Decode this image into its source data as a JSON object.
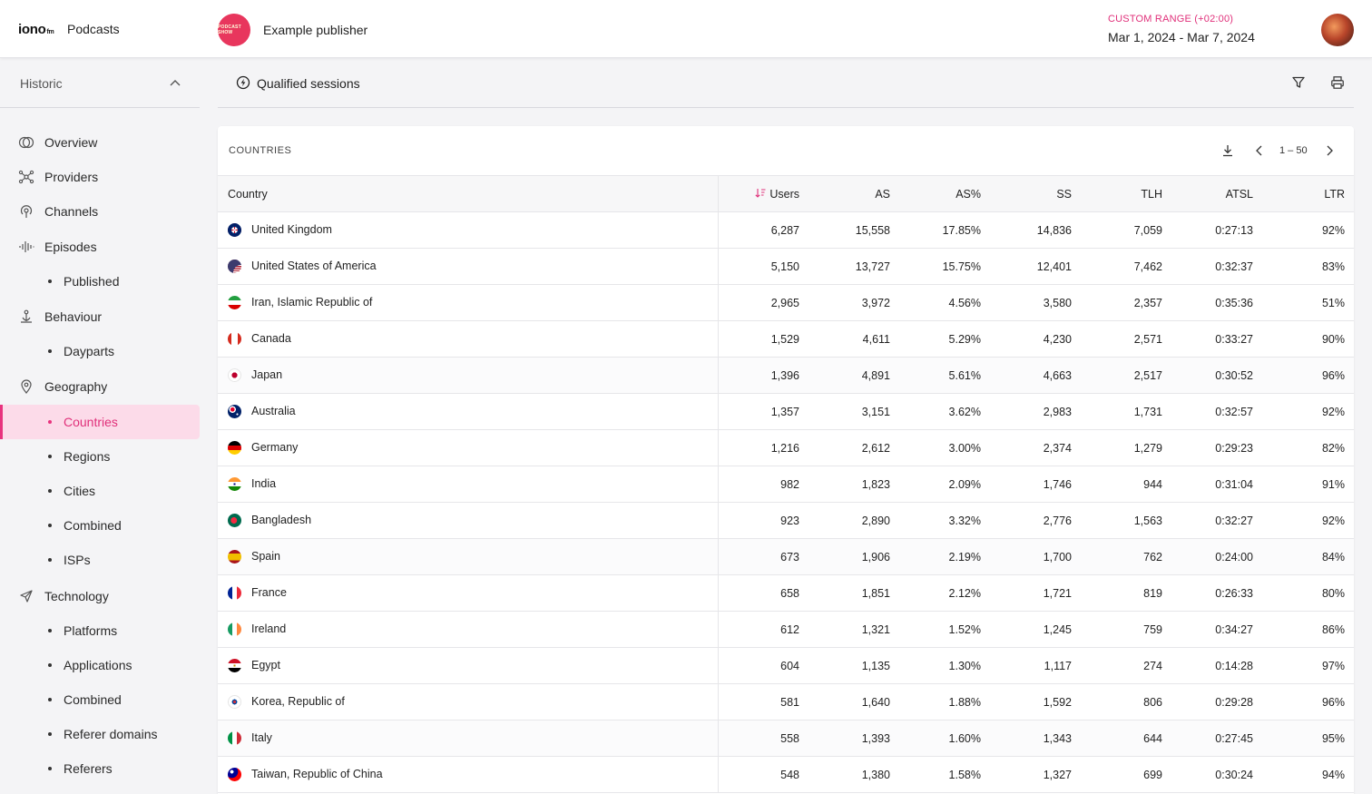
{
  "brand": {
    "logo": "iono",
    "logo_suffix": "fm",
    "app_name": "Podcasts"
  },
  "publisher": {
    "name": "Example publisher",
    "avatar_text": "PODCAST SHOW",
    "avatar_color": "#e8365d"
  },
  "date_range": {
    "label": "CUSTOM RANGE (+02:00)",
    "value": "Mar 1, 2024 - Mar 7, 2024"
  },
  "sidebar": {
    "section": "Historic",
    "items": [
      {
        "label": "Overview",
        "icon": "overview-icon"
      },
      {
        "label": "Providers",
        "icon": "providers-icon"
      },
      {
        "label": "Channels",
        "icon": "channels-icon"
      },
      {
        "label": "Episodes",
        "icon": "episodes-icon"
      },
      {
        "label": "Published",
        "sub": true
      },
      {
        "label": "Behaviour",
        "icon": "behaviour-icon"
      },
      {
        "label": "Dayparts",
        "sub": true
      },
      {
        "label": "Geography",
        "icon": "geography-icon"
      },
      {
        "label": "Countries",
        "sub": true,
        "active": true
      },
      {
        "label": "Regions",
        "sub": true
      },
      {
        "label": "Cities",
        "sub": true
      },
      {
        "label": "Combined",
        "sub": true
      },
      {
        "label": "ISPs",
        "sub": true
      },
      {
        "label": "Technology",
        "icon": "technology-icon"
      },
      {
        "label": "Platforms",
        "sub": true
      },
      {
        "label": "Applications",
        "sub": true
      },
      {
        "label": "Combined",
        "sub": true
      },
      {
        "label": "Referer domains",
        "sub": true
      },
      {
        "label": "Referers",
        "sub": true
      }
    ]
  },
  "metric": {
    "label": "Qualified sessions"
  },
  "table": {
    "title": "COUNTRIES",
    "page_range": "1 – 50",
    "sort_column": "Users",
    "columns": [
      "Country",
      "Users",
      "AS",
      "AS%",
      "SS",
      "TLH",
      "ATSL",
      "LTR"
    ],
    "rows": [
      [
        "United Kingdom",
        "6,287",
        "15,558",
        "17.85%",
        "14,836",
        "7,059",
        "0:27:13",
        "92%"
      ],
      [
        "United States of America",
        "5,150",
        "13,727",
        "15.75%",
        "12,401",
        "7,462",
        "0:32:37",
        "83%"
      ],
      [
        "Iran, Islamic Republic of",
        "2,965",
        "3,972",
        "4.56%",
        "3,580",
        "2,357",
        "0:35:36",
        "51%"
      ],
      [
        "Canada",
        "1,529",
        "4,611",
        "5.29%",
        "4,230",
        "2,571",
        "0:33:27",
        "90%"
      ],
      [
        "Japan",
        "1,396",
        "4,891",
        "5.61%",
        "4,663",
        "2,517",
        "0:30:52",
        "96%"
      ],
      [
        "Australia",
        "1,357",
        "3,151",
        "3.62%",
        "2,983",
        "1,731",
        "0:32:57",
        "92%"
      ],
      [
        "Germany",
        "1,216",
        "2,612",
        "3.00%",
        "2,374",
        "1,279",
        "0:29:23",
        "82%"
      ],
      [
        "India",
        "982",
        "1,823",
        "2.09%",
        "1,746",
        "944",
        "0:31:04",
        "91%"
      ],
      [
        "Bangladesh",
        "923",
        "2,890",
        "3.32%",
        "2,776",
        "1,563",
        "0:32:27",
        "92%"
      ],
      [
        "Spain",
        "673",
        "1,906",
        "2.19%",
        "1,700",
        "762",
        "0:24:00",
        "84%"
      ],
      [
        "France",
        "658",
        "1,851",
        "2.12%",
        "1,721",
        "819",
        "0:26:33",
        "80%"
      ],
      [
        "Ireland",
        "612",
        "1,321",
        "1.52%",
        "1,245",
        "759",
        "0:34:27",
        "86%"
      ],
      [
        "Egypt",
        "604",
        "1,135",
        "1.30%",
        "1,117",
        "274",
        "0:14:28",
        "97%"
      ],
      [
        "Korea, Republic of",
        "581",
        "1,640",
        "1.88%",
        "1,592",
        "806",
        "0:29:28",
        "96%"
      ],
      [
        "Italy",
        "558",
        "1,393",
        "1.60%",
        "1,343",
        "644",
        "0:27:45",
        "95%"
      ],
      [
        "Taiwan, Republic of China",
        "548",
        "1,380",
        "1.58%",
        "1,327",
        "699",
        "0:30:24",
        "94%"
      ]
    ]
  },
  "colors": {
    "accent": "#e0307a",
    "active_bg": "#fcdbe9"
  }
}
